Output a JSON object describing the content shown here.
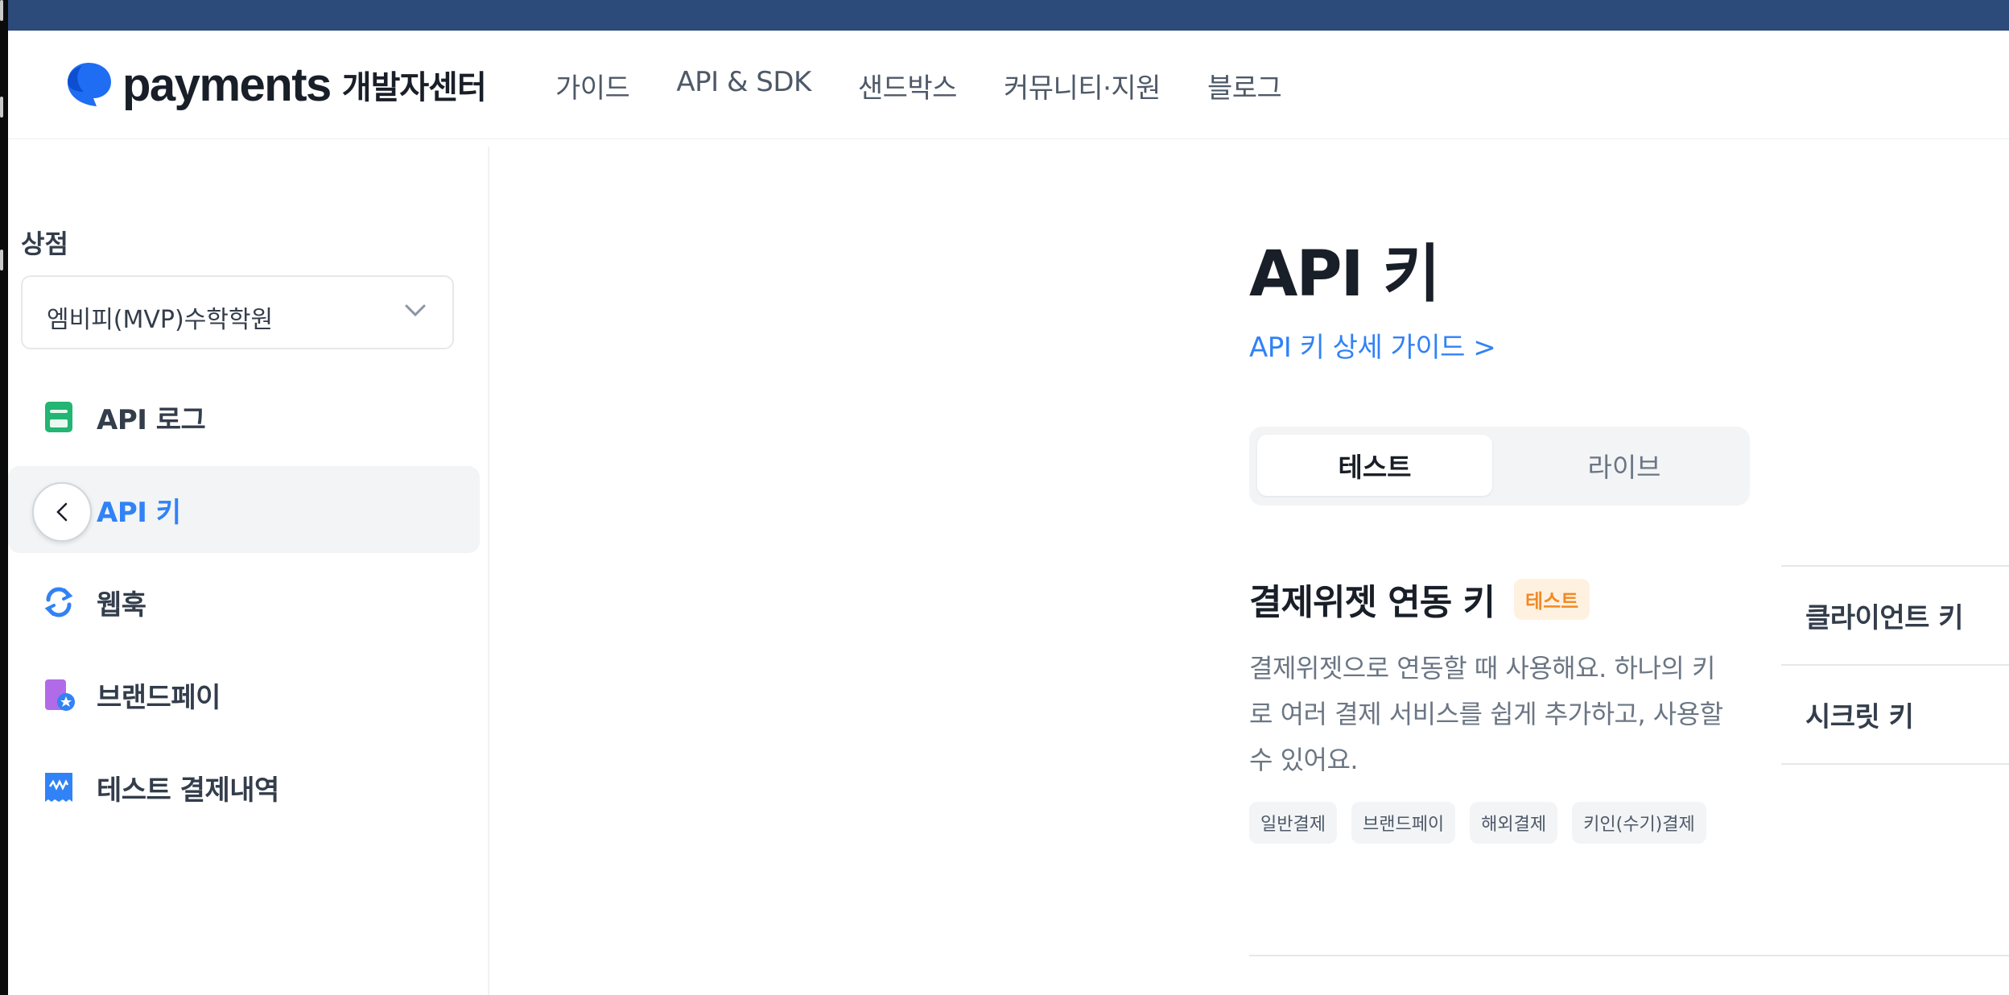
{
  "header": {
    "logo_text": "payments",
    "logo_sub": "개발자센터",
    "nav": [
      "가이드",
      "API & SDK",
      "샌드박스",
      "커뮤니티·지원",
      "블로그"
    ]
  },
  "sidebar": {
    "section_title": "상점",
    "store_select": {
      "value": "엠비피(MVP)수학학원"
    },
    "items": [
      {
        "label": "API 로그",
        "icon": "api-log-icon"
      },
      {
        "label": "API 키",
        "icon": "key-icon",
        "active": true
      },
      {
        "label": "웹훅",
        "icon": "webhook-refresh-icon"
      },
      {
        "label": "브랜드페이",
        "icon": "brandpay-icon"
      },
      {
        "label": "테스트 결제내역",
        "icon": "receipt-icon"
      }
    ]
  },
  "main": {
    "title": "API 키",
    "guide_link": "API 키 상세 가이드 >",
    "tabs": [
      {
        "label": "테스트",
        "selected": true
      },
      {
        "label": "라이브",
        "selected": false
      }
    ],
    "section": {
      "title": "결제위젯 연동 키",
      "badge": "테스트",
      "description": "결제위젯으로 연동할 때 사용해요. 하나의 키로 여러 결제 서비스를 쉽게 추가하고, 사용할 수 있어요.",
      "chips": [
        "일반결제",
        "브랜드페이",
        "해외결제",
        "키인(수기)결제"
      ]
    },
    "keys": [
      "클라이언트 키",
      "시크릿 키"
    ]
  },
  "colors": {
    "accent": "#3182f6",
    "badge_text": "#f08a24",
    "topbar": "#2c4a7a"
  }
}
